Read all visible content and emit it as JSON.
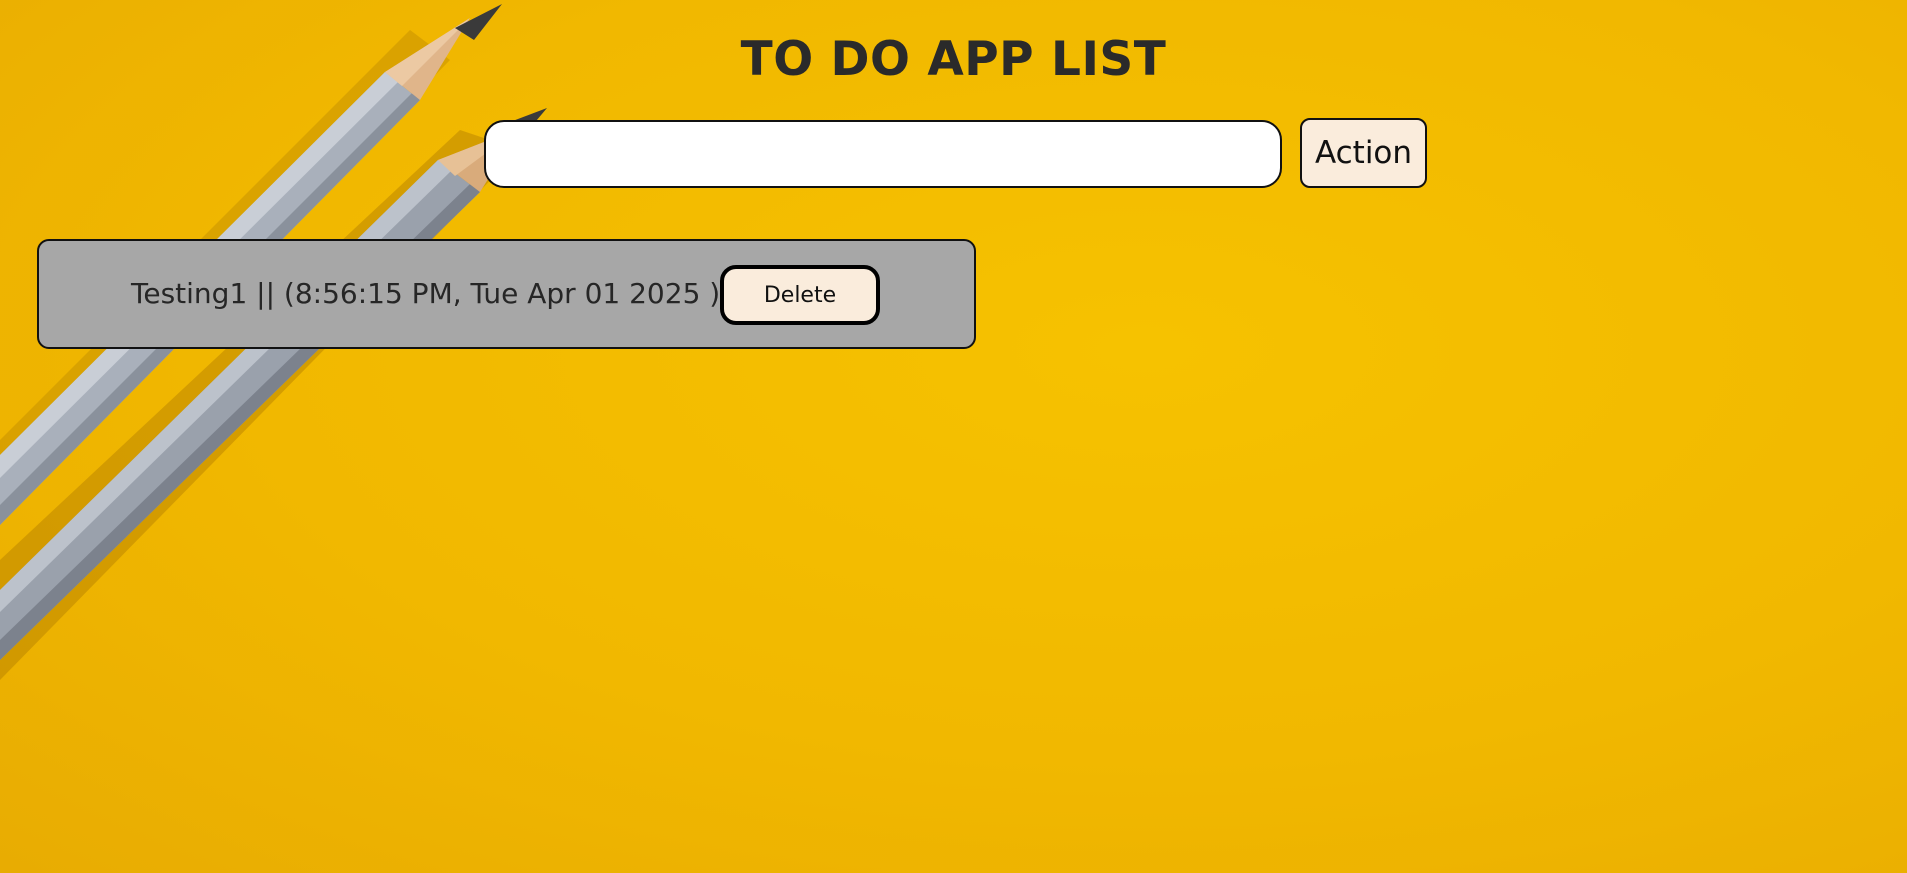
{
  "app": {
    "title": "TO DO APP LIST"
  },
  "form": {
    "input_value": "",
    "input_placeholder": "",
    "action_label": "Action"
  },
  "todos": [
    {
      "text": "Testing1 || (8:56:15 PM, Tue Apr 01 2025 )",
      "delete_label": "Delete"
    }
  ],
  "colors": {
    "background": "#f5c000",
    "card_background": "#a7a7a7",
    "button_background": "#faecdc",
    "text": "#2a2a2a"
  },
  "decorations": {
    "background_image": "pencils-icon"
  }
}
